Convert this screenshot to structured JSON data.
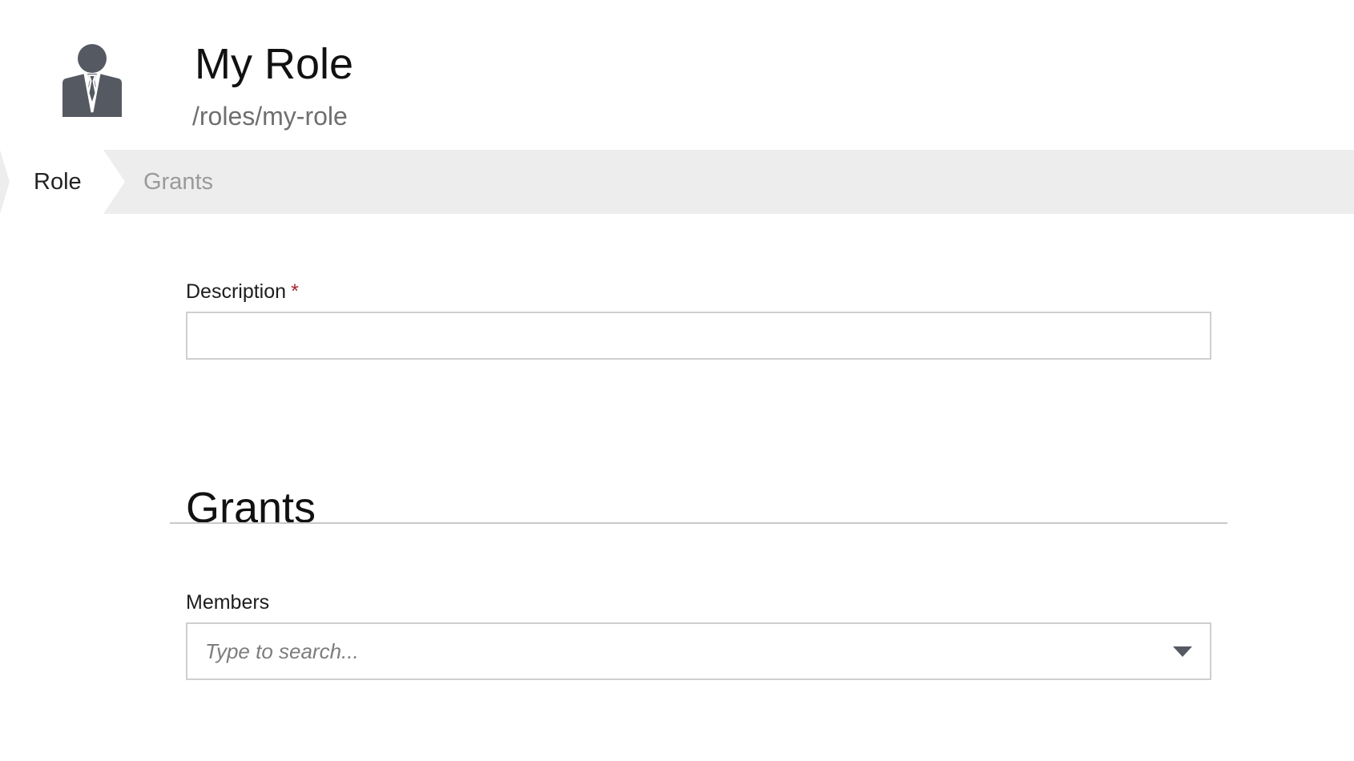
{
  "header": {
    "icon": "role-person-icon",
    "title": "My Role",
    "path": "/roles/my-role"
  },
  "tabs": [
    {
      "label": "Role",
      "active": true
    },
    {
      "label": "Grants",
      "active": false
    }
  ],
  "form": {
    "description": {
      "label": "Description",
      "required_marker": "*",
      "value": ""
    },
    "grants_section": {
      "title": "Grants"
    },
    "members": {
      "label": "Members",
      "placeholder": "Type to search..."
    }
  },
  "colors": {
    "tab_bar_bg": "#ededed",
    "required": "#a6262c",
    "icon": "#555a62",
    "muted_text": "#9a9a9a"
  }
}
